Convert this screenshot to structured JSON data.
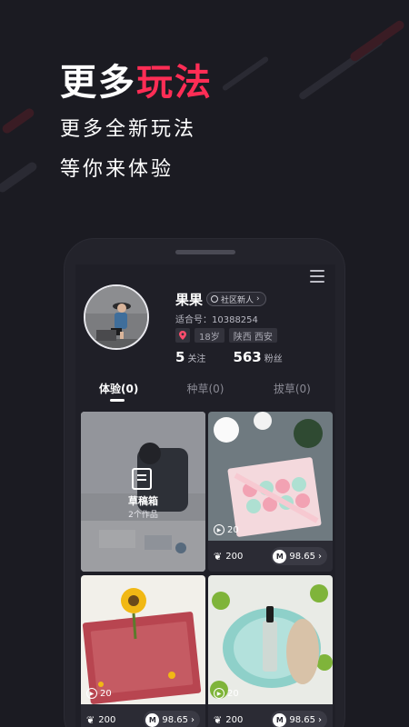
{
  "hero": {
    "title_prefix": "更多",
    "title_accent": "玩法",
    "subtitle_line1": "更多全新玩法",
    "subtitle_line2": "等你来体验",
    "accent_color": "#ff2d55"
  },
  "profile": {
    "name": "果果",
    "badge": "社区新人",
    "uid": "适合号：10388254",
    "age_tag": "18岁",
    "location_tag": "陕西 西安",
    "following_count": "5",
    "following_label": "关注",
    "followers_count": "563",
    "followers_label": "粉丝"
  },
  "tabs": [
    {
      "label": "体验(0)"
    },
    {
      "label": "种草(0)"
    },
    {
      "label": "拔草(0)"
    }
  ],
  "draft": {
    "title": "草稿箱",
    "subtitle": "2个作品"
  },
  "cards": [
    {
      "plays": "20",
      "likes": "200",
      "price": "98.65",
      "m": "M"
    },
    {
      "plays": "20",
      "likes": "200",
      "price": "98.65",
      "m": "M"
    },
    {
      "plays": "20",
      "likes": "200",
      "price": "98.65",
      "m": "M"
    }
  ],
  "icons": {
    "menu": "menu-icon",
    "location": "location-pin-icon",
    "like": "sprout-icon",
    "play": "play-icon",
    "coin": "m-coin-icon",
    "draft": "draft-box-icon"
  }
}
